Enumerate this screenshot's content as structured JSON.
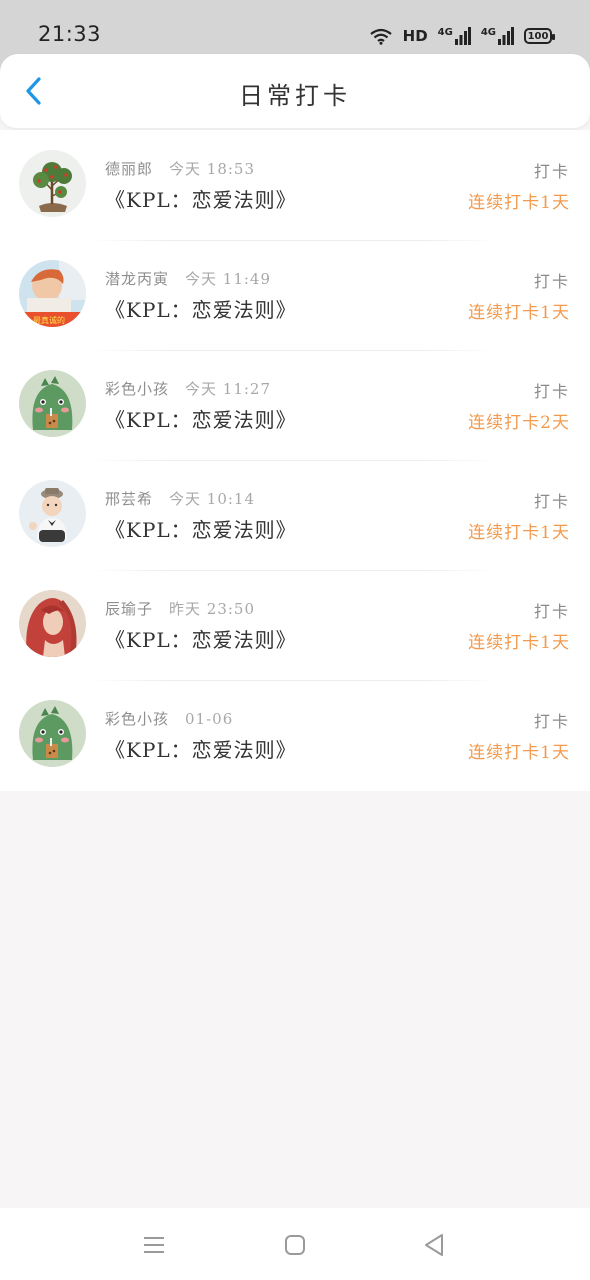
{
  "status_bar": {
    "time": "21:33",
    "network_label": "HD",
    "signal_1_label": "4G",
    "signal_2_label": "4G",
    "battery": "100"
  },
  "header": {
    "title": "日常打卡",
    "back_icon": "chevron-left-icon"
  },
  "colors": {
    "accent_blue": "#1e96e8",
    "streak_orange": "#f39a4e",
    "meta_gray": "#8f8f8f"
  },
  "checkins": [
    {
      "user": "德丽郎",
      "time": "今天 18:53",
      "course": "《KPL：恋爱法则》",
      "action": "打卡",
      "streak": "连续打卡1天",
      "avatar": "plant-avatar"
    },
    {
      "user": "潜龙丙寅",
      "time": "今天 11:49",
      "course": "《KPL：恋爱法则》",
      "action": "打卡",
      "streak": "连续打卡1天",
      "avatar": "photo-avatar"
    },
    {
      "user": "彩色小孩",
      "time": "今天 11:27",
      "course": "《KPL：恋爱法则》",
      "action": "打卡",
      "streak": "连续打卡2天",
      "avatar": "dinosaur-avatar"
    },
    {
      "user": "邢芸希",
      "time": "今天 10:14",
      "course": "《KPL：恋爱法则》",
      "action": "打卡",
      "streak": "连续打卡1天",
      "avatar": "baby-avatar"
    },
    {
      "user": "辰瑜子",
      "time": "昨天 23:50",
      "course": "《KPL：恋爱法则》",
      "action": "打卡",
      "streak": "连续打卡1天",
      "avatar": "red-hair-avatar"
    },
    {
      "user": "彩色小孩",
      "time": "01-06",
      "course": "《KPL：恋爱法则》",
      "action": "打卡",
      "streak": "连续打卡1天",
      "avatar": "dinosaur-avatar"
    }
  ],
  "nav_bar": {
    "menu_icon": "menu-icon",
    "home_icon": "home-square-icon",
    "back_icon": "back-triangle-icon"
  }
}
